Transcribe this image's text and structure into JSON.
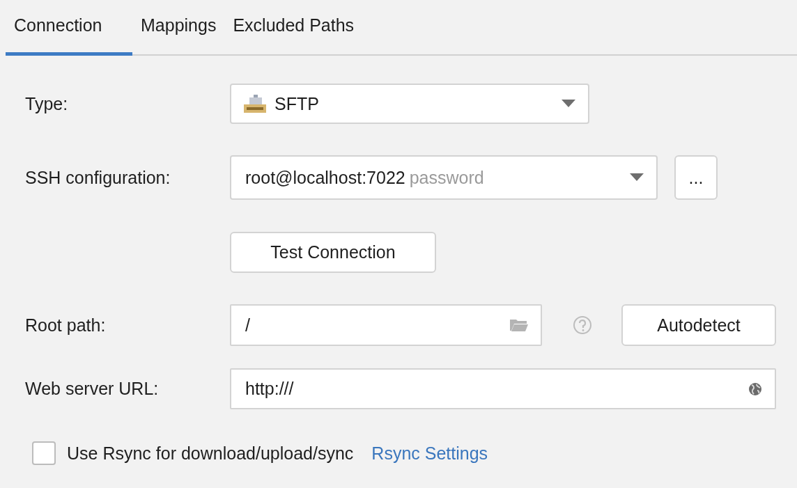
{
  "tabs": [
    {
      "label": "Connection",
      "selected": true
    },
    {
      "label": "Mappings",
      "selected": false
    },
    {
      "label": "Excluded Paths",
      "selected": false
    }
  ],
  "type": {
    "label": "Type:",
    "value": "SFTP"
  },
  "ssh": {
    "label": "SSH configuration:",
    "value": "root@localhost:7022",
    "hint": "password",
    "more": "..."
  },
  "test_button": "Test Connection",
  "root_path": {
    "label": "Root path:",
    "value": "/",
    "autodetect": "Autodetect"
  },
  "web_url": {
    "label": "Web server URL:",
    "value": "http:///"
  },
  "rsync": {
    "label": "Use Rsync for download/upload/sync",
    "checked": false,
    "link": "Rsync Settings"
  }
}
